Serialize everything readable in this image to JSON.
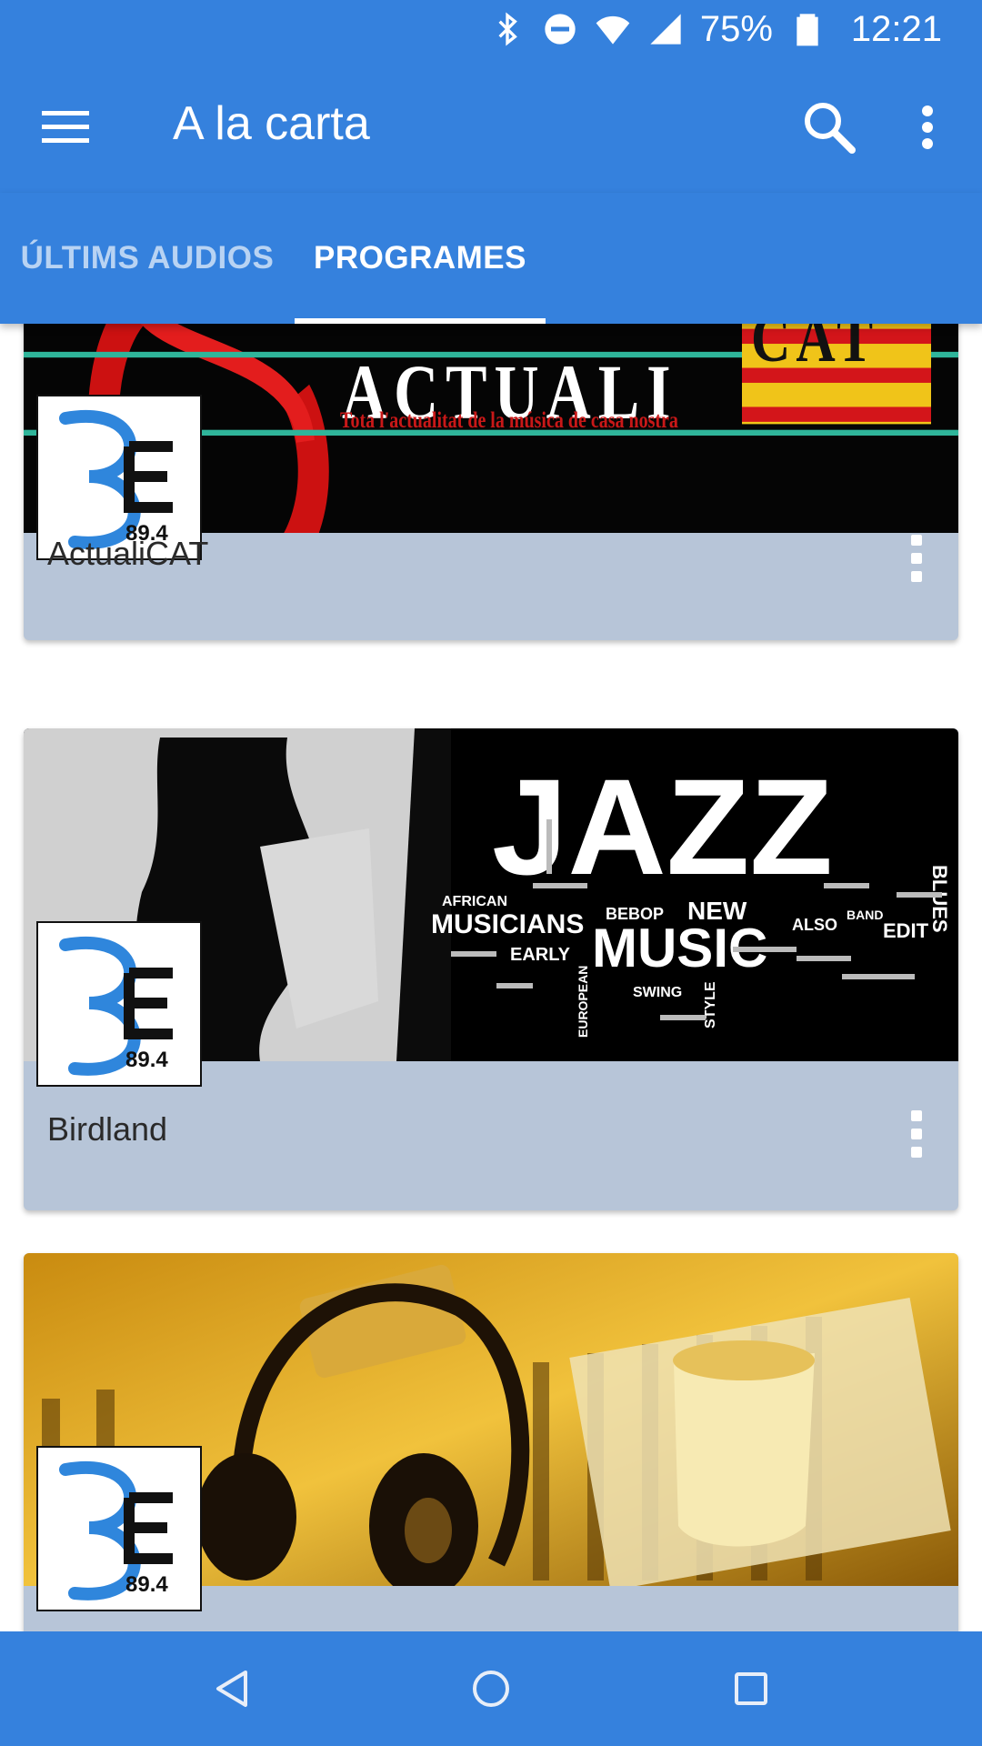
{
  "status_bar": {
    "icons": [
      "bluetooth-icon",
      "do-not-disturb-icon",
      "wifi-icon",
      "cell-signal-icon",
      "battery-icon"
    ],
    "battery": "75%",
    "time": "12:21"
  },
  "app_bar": {
    "title": "A la carta",
    "icons": [
      "menu-icon",
      "search-icon",
      "more-vert-icon"
    ]
  },
  "tabs": [
    {
      "label": "ÚLTIMS AUDIOS",
      "selected": false
    },
    {
      "label": "PROGRAMES",
      "selected": true
    }
  ],
  "programs": [
    {
      "title": "ActualiCAT",
      "banner_heading": "ACTUALI",
      "banner_flag_text": "CAT",
      "banner_tagline": "Tota l'actualitat de la música de casa nostra",
      "logo_text": "89.4"
    },
    {
      "title": "Birdland",
      "banner_words": [
        "JAZZ",
        "MUSICIANS",
        "NEW",
        "MUSIC",
        "BLUES",
        "AFRICAN",
        "BEBOP",
        "EARLY",
        "EDIT",
        "ALSO",
        "SWING",
        "STYLE",
        "BAND",
        "EUROPEAN"
      ],
      "logo_text": "89.4"
    },
    {
      "title": "",
      "logo_text": "89.4"
    }
  ],
  "nav_bar": {
    "icons": [
      "back-icon",
      "home-icon",
      "recents-icon"
    ]
  },
  "colors": {
    "primary": "#3581dd",
    "card_background": "#b7c5d8",
    "logo_blue": "#2f86dc"
  }
}
